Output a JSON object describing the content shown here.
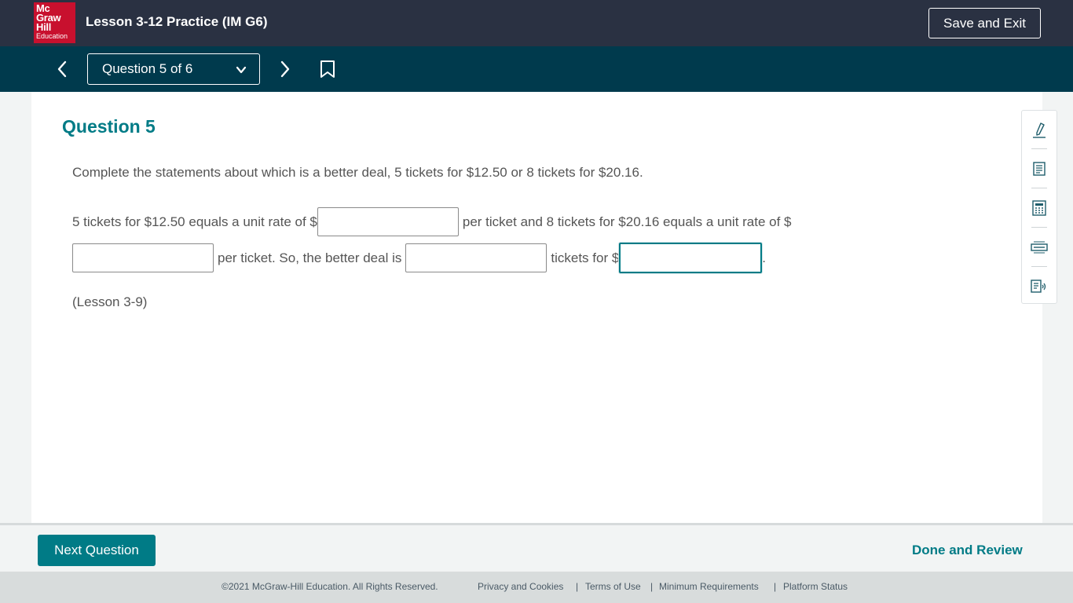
{
  "header": {
    "logo_lines": [
      "Mc",
      "Graw",
      "Hill",
      "Education"
    ],
    "title": "Lesson 3-12 Practice (IM G6)",
    "save_exit_label": "Save and Exit",
    "brand_color": "#c8102e"
  },
  "nav": {
    "question_selector": "Question 5 of 6",
    "prev_icon": "chevron-left-icon",
    "next_icon": "chevron-right-icon",
    "bookmark_icon": "bookmark-icon"
  },
  "question": {
    "heading": "Question 5",
    "prompt": "Complete the statements about which is a better deal, 5 tickets for $12.50 or 8 tickets for $20.16.",
    "line1_part1": "5 tickets for $12.50 equals a unit rate of $",
    "line1_part2": "per ticket and 8 tickets for $20.16 equals a unit rate of $",
    "line2_part1": "per ticket. So, the better deal is",
    "line2_part2": "tickets for $",
    "line2_end": ".",
    "blanks": [
      "",
      "",
      "",
      ""
    ],
    "lesson_ref": "(Lesson 3-9)"
  },
  "tools": [
    "highlighter-icon",
    "notepad-icon",
    "calculator-icon",
    "line-reader-icon",
    "text-to-speech-icon"
  ],
  "footer": {
    "next_label": "Next Question",
    "done_label": "Done and Review"
  },
  "legal": {
    "copyright": "©2021 McGraw-Hill Education. All Rights Reserved.",
    "links": [
      "Privacy and Cookies",
      "Terms of Use",
      "Minimum Requirements",
      "Platform Status"
    ]
  },
  "colors": {
    "topbar": "#2a3142",
    "navbar": "#003a4d",
    "accent": "#007b86"
  }
}
